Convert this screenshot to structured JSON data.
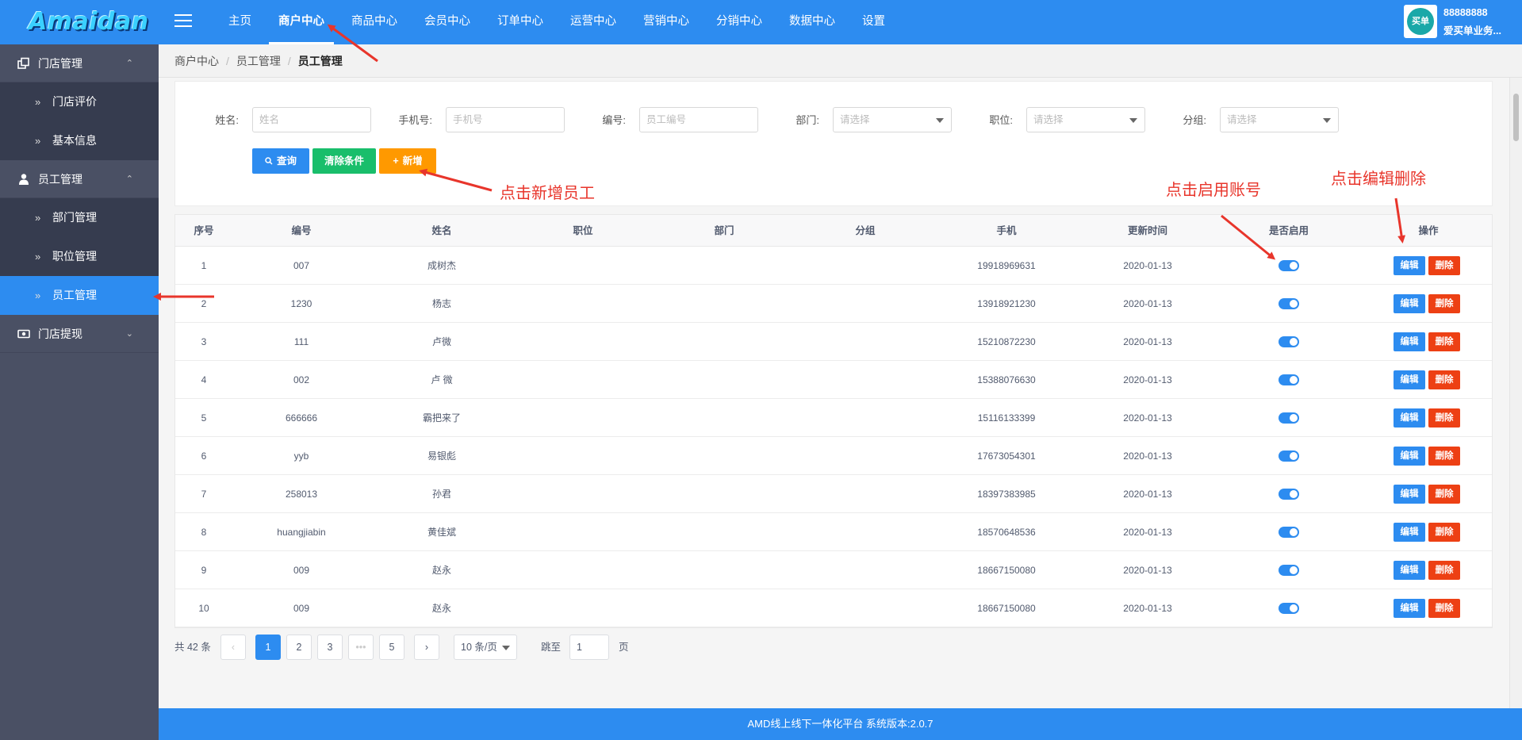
{
  "brand": {
    "logo": "Amaidan"
  },
  "nav": {
    "items": [
      "主页",
      "商户中心",
      "商品中心",
      "会员中心",
      "订单中心",
      "运营中心",
      "营销中心",
      "分销中心",
      "数据中心",
      "设置"
    ],
    "active_index": 1
  },
  "user": {
    "avatar_text": "买单",
    "id": "88888888",
    "name": "爱买单业务..."
  },
  "sidebar": {
    "groups": [
      {
        "label": "门店管理",
        "icon": "store-icon",
        "expanded": true,
        "items": [
          "门店评价",
          "基本信息"
        ]
      },
      {
        "label": "员工管理",
        "icon": "user-icon",
        "expanded": true,
        "items": [
          "部门管理",
          "职位管理",
          "员工管理"
        ],
        "active_item": "员工管理"
      },
      {
        "label": "门店提现",
        "icon": "cash-icon",
        "expanded": false,
        "items": []
      }
    ]
  },
  "breadcrumb": [
    "商户中心",
    "员工管理",
    "员工管理"
  ],
  "filters": {
    "name": {
      "label": "姓名:",
      "placeholder": "姓名"
    },
    "phone": {
      "label": "手机号:",
      "placeholder": "手机号"
    },
    "code": {
      "label": "编号:",
      "placeholder": "员工编号"
    },
    "dept": {
      "label": "部门:",
      "placeholder": "请选择"
    },
    "position": {
      "label": "职位:",
      "placeholder": "请选择"
    },
    "group": {
      "label": "分组:",
      "placeholder": "请选择"
    }
  },
  "buttons": {
    "query": "查询",
    "clear": "清除条件",
    "add": "新增"
  },
  "table": {
    "headers": [
      "序号",
      "编号",
      "姓名",
      "职位",
      "部门",
      "分组",
      "手机",
      "更新时间",
      "是否启用",
      "操作"
    ],
    "edit_label": "编辑",
    "delete_label": "删除",
    "rows": [
      {
        "idx": "1",
        "code": "007",
        "name": "成树杰",
        "position": "",
        "dept": "",
        "group": "",
        "phone": "19918969631",
        "updated": "2020-01-13",
        "enabled": true
      },
      {
        "idx": "2",
        "code": "1230",
        "name": "杨志",
        "position": "",
        "dept": "",
        "group": "",
        "phone": "13918921230",
        "updated": "2020-01-13",
        "enabled": true
      },
      {
        "idx": "3",
        "code": "111",
        "name": "卢微",
        "position": "",
        "dept": "",
        "group": "",
        "phone": "15210872230",
        "updated": "2020-01-13",
        "enabled": true
      },
      {
        "idx": "4",
        "code": "002",
        "name": "卢 微",
        "position": "",
        "dept": "",
        "group": "",
        "phone": "15388076630",
        "updated": "2020-01-13",
        "enabled": true
      },
      {
        "idx": "5",
        "code": "666666",
        "name": "霸把来了",
        "position": "",
        "dept": "",
        "group": "",
        "phone": "15116133399",
        "updated": "2020-01-13",
        "enabled": true
      },
      {
        "idx": "6",
        "code": "yyb",
        "name": "易银彪",
        "position": "",
        "dept": "",
        "group": "",
        "phone": "17673054301",
        "updated": "2020-01-13",
        "enabled": true
      },
      {
        "idx": "7",
        "code": "258013",
        "name": "孙君",
        "position": "",
        "dept": "",
        "group": "",
        "phone": "18397383985",
        "updated": "2020-01-13",
        "enabled": true
      },
      {
        "idx": "8",
        "code": "huangjiabin",
        "name": "黄佳斌",
        "position": "",
        "dept": "",
        "group": "",
        "phone": "18570648536",
        "updated": "2020-01-13",
        "enabled": true
      },
      {
        "idx": "9",
        "code": "009",
        "name": "赵永",
        "position": "",
        "dept": "",
        "group": "",
        "phone": "18667150080",
        "updated": "2020-01-13",
        "enabled": true
      },
      {
        "idx": "10",
        "code": "009",
        "name": "赵永",
        "position": "",
        "dept": "",
        "group": "",
        "phone": "18667150080",
        "updated": "2020-01-13",
        "enabled": true
      }
    ]
  },
  "pagination": {
    "total": "共 42 条",
    "prev": "‹",
    "next": "›",
    "pages": [
      "1",
      "2",
      "3",
      "•••",
      "5"
    ],
    "current": "1",
    "page_size": "10 条/页",
    "jump_label": "跳至",
    "jump_value": "1",
    "page_suffix": "页"
  },
  "footer": {
    "text": "AMD线上线下一体化平台 系统版本:2.0.7"
  },
  "annotations": {
    "add_employee": "点击新增员工",
    "enable_account": "点击启用账号",
    "edit_delete": "点击编辑删除"
  },
  "colors": {
    "primary": "#2d8cf0",
    "success": "#19be6b",
    "warning": "#ff9900",
    "danger": "#ed4014",
    "sidebar": "#4a5064",
    "annotation": "#e8352b"
  }
}
